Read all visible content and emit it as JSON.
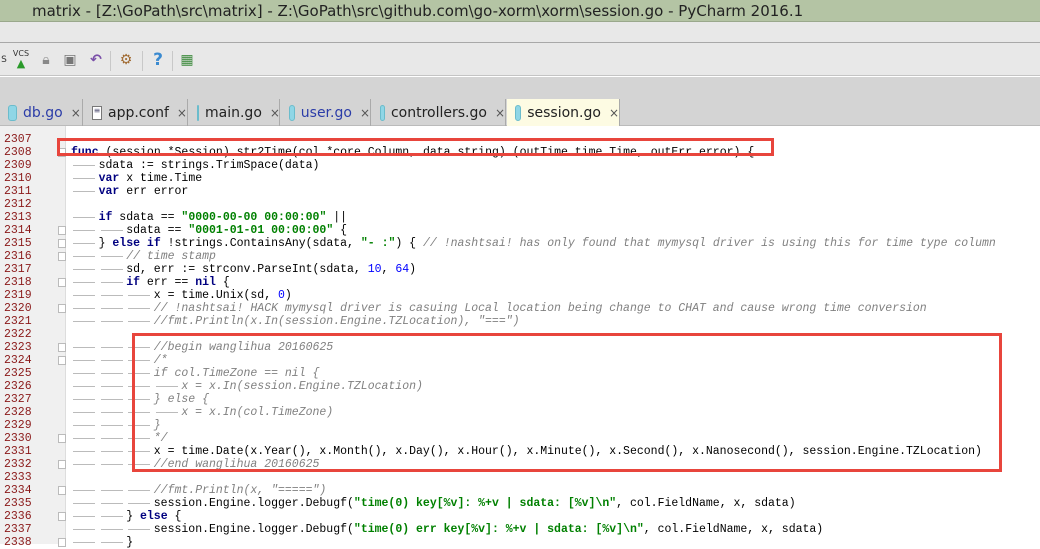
{
  "window": {
    "title": "matrix - [Z:\\GoPath\\src\\matrix] - Z:\\GoPath\\src\\github.com\\go-xorm\\xorm\\session.go - PyCharm 2016.1"
  },
  "toolbar": {
    "partial_label": "S",
    "vcs_label": "VCS",
    "help_label": "?"
  },
  "tabs": [
    {
      "label": "db.go",
      "icon": "go-file-icon",
      "active": false
    },
    {
      "label": "app.conf",
      "icon": "text-file-icon",
      "active": false
    },
    {
      "label": "main.go",
      "icon": "go-file-icon",
      "active": false
    },
    {
      "label": "user.go",
      "icon": "go-file-icon",
      "active": false
    },
    {
      "label": "controllers.go",
      "icon": "go-file-icon",
      "active": false
    },
    {
      "label": "session.go",
      "icon": "go-file-icon",
      "active": true
    }
  ],
  "tab_close": "×",
  "colors": {
    "highlight_box": "#e8453c",
    "line_number": "#8b1a1a",
    "keyword": "#000080",
    "string": "#008000",
    "comment": "#808080"
  },
  "code": [
    {
      "n": "2307",
      "i": 0,
      "s": []
    },
    {
      "n": "2308",
      "i": 0,
      "s": [
        [
          "k",
          "func"
        ],
        [
          "t",
          " (session *Session) str2Time(col *core.Column, data string) (outTime time.Time, outErr error) {"
        ]
      ]
    },
    {
      "n": "2309",
      "i": 1,
      "s": [
        [
          "t",
          "sdata := strings.TrimSpace(data)"
        ]
      ]
    },
    {
      "n": "2310",
      "i": 1,
      "s": [
        [
          "k",
          "var"
        ],
        [
          "t",
          " x time.Time"
        ]
      ]
    },
    {
      "n": "2311",
      "i": 1,
      "s": [
        [
          "k",
          "var"
        ],
        [
          "t",
          " err error"
        ]
      ]
    },
    {
      "n": "2312",
      "i": 0,
      "s": []
    },
    {
      "n": "2313",
      "i": 1,
      "s": [
        [
          "k",
          "if"
        ],
        [
          "t",
          " sdata == "
        ],
        [
          "s",
          "\"0000-00-00 00:00:00\""
        ],
        [
          "t",
          " ||"
        ]
      ]
    },
    {
      "n": "2314",
      "i": 2,
      "s": [
        [
          "t",
          "sdata == "
        ],
        [
          "s",
          "\"0001-01-01 00:00:00\""
        ],
        [
          "t",
          " {"
        ]
      ]
    },
    {
      "n": "2315",
      "i": 1,
      "s": [
        [
          "t",
          "} "
        ],
        [
          "k",
          "else if"
        ],
        [
          "t",
          " !strings.ContainsAny(sdata, "
        ],
        [
          "s",
          "\"- :\""
        ],
        [
          "t",
          ") { "
        ],
        [
          "c",
          "// !nashtsai! has only found that mymysql driver is using this for time type column"
        ]
      ]
    },
    {
      "n": "2316",
      "i": 2,
      "s": [
        [
          "c",
          "// time stamp"
        ]
      ]
    },
    {
      "n": "2317",
      "i": 2,
      "s": [
        [
          "t",
          "sd, err := strconv.ParseInt(sdata, "
        ],
        [
          "n",
          "10"
        ],
        [
          "t",
          ", "
        ],
        [
          "n",
          "64"
        ],
        [
          "t",
          ")"
        ]
      ]
    },
    {
      "n": "2318",
      "i": 2,
      "s": [
        [
          "k",
          "if"
        ],
        [
          "t",
          " err == "
        ],
        [
          "k",
          "nil"
        ],
        [
          "t",
          " {"
        ]
      ]
    },
    {
      "n": "2319",
      "i": 3,
      "s": [
        [
          "t",
          "x = time.Unix(sd, "
        ],
        [
          "n",
          "0"
        ],
        [
          "t",
          ")"
        ]
      ]
    },
    {
      "n": "2320",
      "i": 3,
      "s": [
        [
          "c",
          "// !nashtsai! HACK mymysql driver is casuing Local location being change to CHAT and cause wrong time conversion"
        ]
      ]
    },
    {
      "n": "2321",
      "i": 3,
      "s": [
        [
          "c",
          "//fmt.Println(x.In(session.Engine.TZLocation), \"===\")"
        ]
      ]
    },
    {
      "n": "2322",
      "i": 0,
      "s": []
    },
    {
      "n": "2323",
      "i": 3,
      "s": [
        [
          "c",
          "//begin wanglihua 20160625"
        ]
      ]
    },
    {
      "n": "2324",
      "i": 3,
      "s": [
        [
          "c",
          "/*"
        ]
      ]
    },
    {
      "n": "2325",
      "i": 3,
      "s": [
        [
          "c",
          "if col.TimeZone == nil {"
        ]
      ]
    },
    {
      "n": "2326",
      "i": 4,
      "s": [
        [
          "c",
          "x = x.In(session.Engine.TZLocation)"
        ]
      ]
    },
    {
      "n": "2327",
      "i": 3,
      "s": [
        [
          "c",
          "} else {"
        ]
      ]
    },
    {
      "n": "2328",
      "i": 4,
      "s": [
        [
          "c",
          "x = x.In(col.TimeZone)"
        ]
      ]
    },
    {
      "n": "2329",
      "i": 3,
      "s": [
        [
          "c",
          "}"
        ]
      ]
    },
    {
      "n": "2330",
      "i": 3,
      "s": [
        [
          "c",
          "*/"
        ]
      ]
    },
    {
      "n": "2331",
      "i": 3,
      "s": [
        [
          "t",
          "x = time.Date(x.Year(), x.Month(), x.Day(), x.Hour(), x.Minute(), x.Second(), x.Nanosecond(), session.Engine.TZLocation)"
        ]
      ]
    },
    {
      "n": "2332",
      "i": 3,
      "s": [
        [
          "c",
          "//end wanglihua 20160625"
        ]
      ]
    },
    {
      "n": "2333",
      "i": 0,
      "s": []
    },
    {
      "n": "2334",
      "i": 3,
      "s": [
        [
          "c",
          "//fmt.Println(x, \"=====\")"
        ]
      ]
    },
    {
      "n": "2335",
      "i": 3,
      "s": [
        [
          "t",
          "session.Engine.logger.Debugf("
        ],
        [
          "s",
          "\"time(0) key[%v]: %+v | sdata: [%v]\\n\""
        ],
        [
          "t",
          ", col.FieldName, x, sdata)"
        ]
      ]
    },
    {
      "n": "2336",
      "i": 2,
      "s": [
        [
          "t",
          "} "
        ],
        [
          "k",
          "else"
        ],
        [
          "t",
          " {"
        ]
      ]
    },
    {
      "n": "2337",
      "i": 3,
      "s": [
        [
          "t",
          "session.Engine.logger.Debugf("
        ],
        [
          "s",
          "\"time(0) err key[%v]: %+v | sdata: [%v]\\n\""
        ],
        [
          "t",
          ", col.FieldName, x, sdata)"
        ]
      ]
    },
    {
      "n": "2338",
      "i": 2,
      "s": [
        [
          "t",
          "}"
        ]
      ]
    }
  ]
}
